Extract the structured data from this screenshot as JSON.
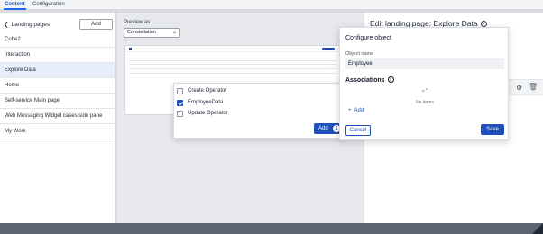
{
  "tabs": [
    {
      "label": "Content",
      "active": true
    },
    {
      "label": "Configuration",
      "active": false
    }
  ],
  "sidebar": {
    "back_label": "Landing pages",
    "add_label": "Add",
    "items": [
      {
        "label": "Cube2"
      },
      {
        "label": "Interaction"
      },
      {
        "label": "Explore Data",
        "selected": true
      },
      {
        "label": "Home"
      },
      {
        "label": "Self-service Main page"
      },
      {
        "label": "Web Messaging Widget cases side pane"
      },
      {
        "label": "My Work"
      }
    ]
  },
  "preview": {
    "label": "Preview as",
    "selected": "Constellation"
  },
  "operator_popover": {
    "options": [
      {
        "label": "Create Operator",
        "checked": false
      },
      {
        "label": "EmployeeData",
        "checked": true
      },
      {
        "label": "Update Operator",
        "checked": false
      }
    ],
    "add_label": "Add",
    "count": "1"
  },
  "right_panel": {
    "title": "Edit landing page: Explore Data",
    "icons": [
      "gear-icon",
      "trash-icon"
    ]
  },
  "modal": {
    "title": "Configure object",
    "object_name_label": "Object name",
    "object_name_value": "Employee",
    "associations_title": "Associations",
    "no_items": "No items",
    "add_label": "Add",
    "cancel_label": "Cancel",
    "save_label": "Save"
  },
  "colors": {
    "accent": "#1f4fb8",
    "selected_bg": "#e7eef9"
  }
}
